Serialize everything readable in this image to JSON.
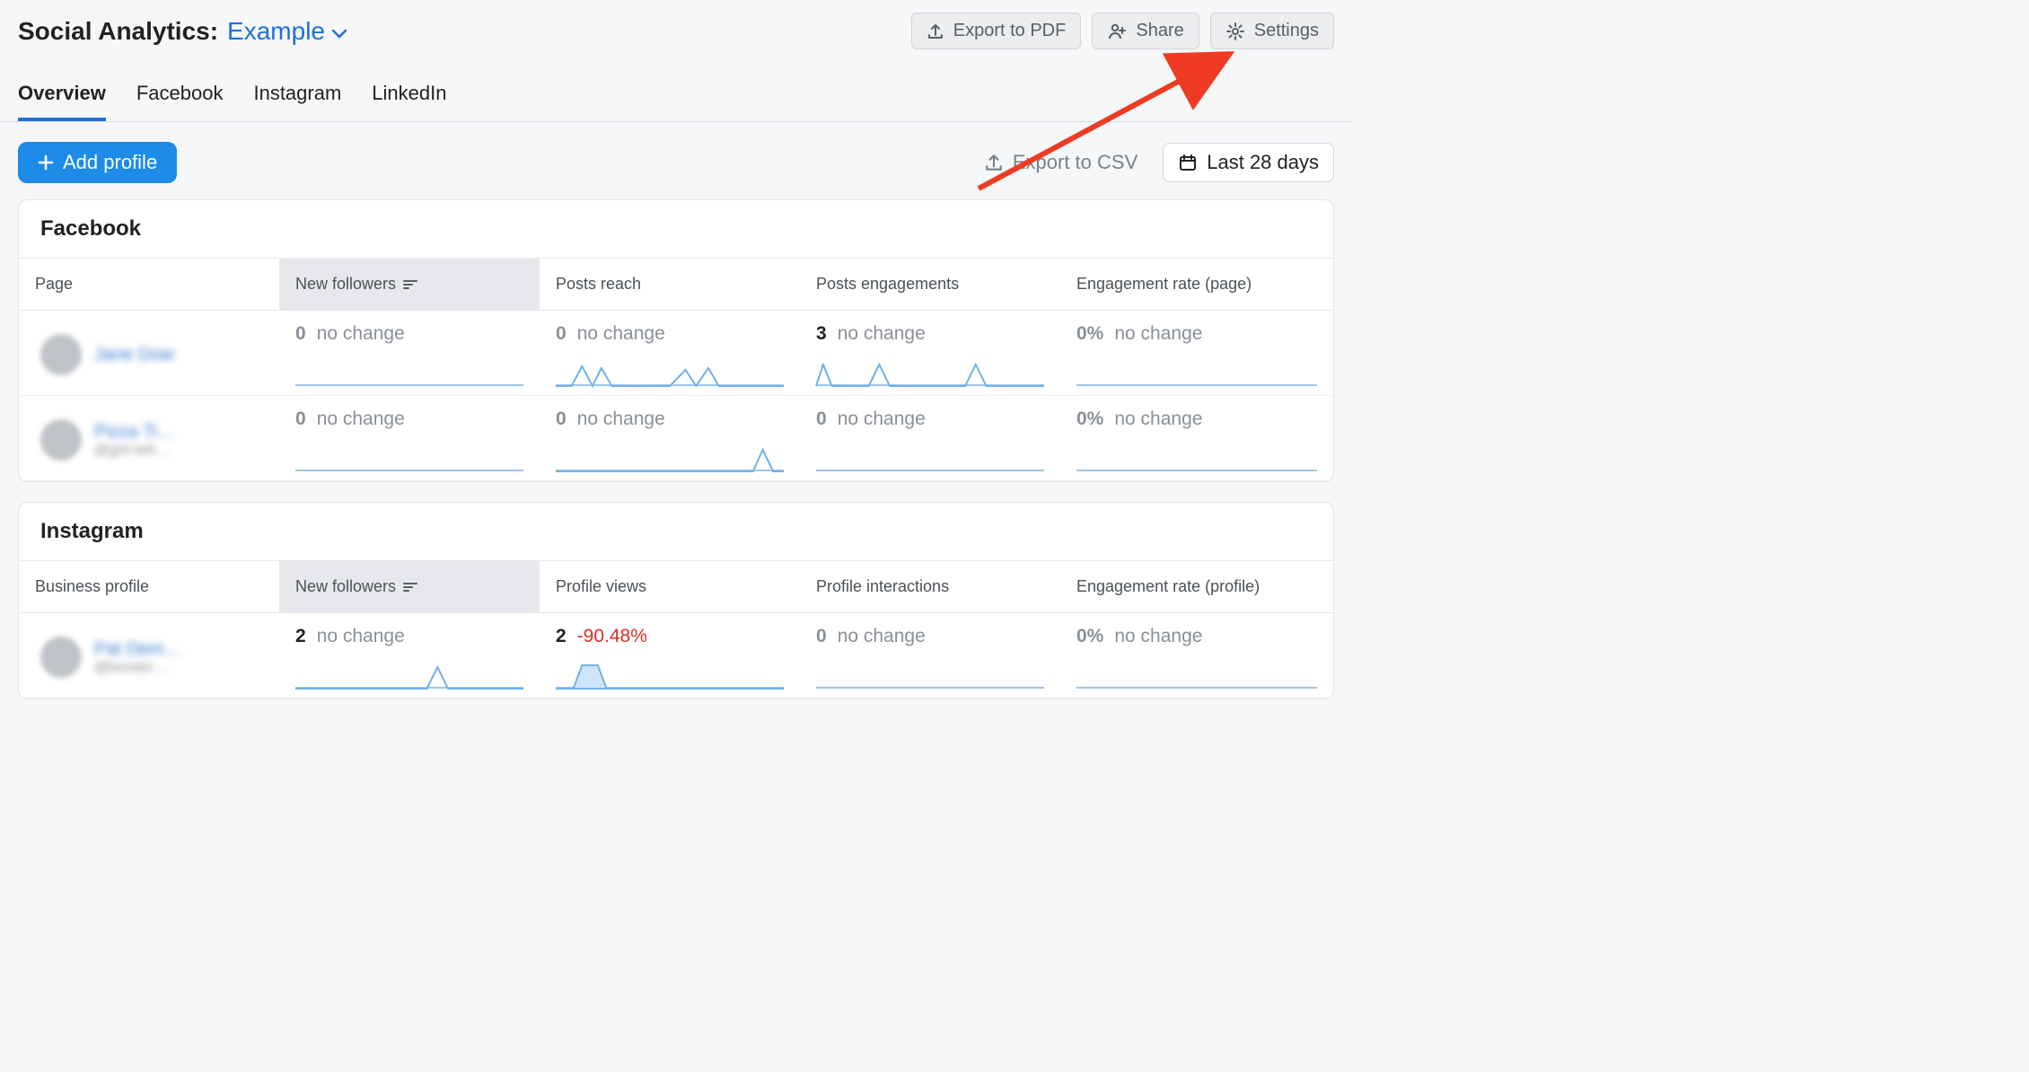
{
  "header": {
    "title_prefix": "Social Analytics:",
    "project_name": "Example",
    "buttons": {
      "export_pdf": "Export to PDF",
      "share": "Share",
      "settings": "Settings"
    }
  },
  "tabs": {
    "overview": "Overview",
    "facebook": "Facebook",
    "instagram": "Instagram",
    "linkedin": "LinkedIn"
  },
  "toolbar": {
    "add_profile": "Add profile",
    "export_csv": "Export to CSV",
    "date_range": "Last 28 days"
  },
  "facebook_panel": {
    "title": "Facebook",
    "columns": {
      "page": "Page",
      "new_followers": "New followers",
      "posts_reach": "Posts reach",
      "posts_engagements": "Posts engagements",
      "engagement_rate": "Engagement rate (page)"
    },
    "rows": [
      {
        "name": "Jane Dow",
        "sub": "",
        "new_followers": {
          "value": "0",
          "change": "no change"
        },
        "posts_reach": {
          "value": "0",
          "change": "no change"
        },
        "posts_engagements": {
          "value": "3",
          "change": "no change"
        },
        "engagement_rate": {
          "value": "0%",
          "change": "no change"
        }
      },
      {
        "name": "Pizza Ti…",
        "sub": "@grd twh…",
        "new_followers": {
          "value": "0",
          "change": "no change"
        },
        "posts_reach": {
          "value": "0",
          "change": "no change"
        },
        "posts_engagements": {
          "value": "0",
          "change": "no change"
        },
        "engagement_rate": {
          "value": "0%",
          "change": "no change"
        }
      }
    ]
  },
  "instagram_panel": {
    "title": "Instagram",
    "columns": {
      "profile": "Business profile",
      "new_followers": "New followers",
      "profile_views": "Profile views",
      "profile_interactions": "Profile interactions",
      "engagement_rate": "Engagement rate (profile)"
    },
    "rows": [
      {
        "name": "Pat Dem…",
        "sub": "@bonder…",
        "new_followers": {
          "value": "2",
          "change": "no change"
        },
        "profile_views": {
          "value": "2",
          "change": "-90.48%",
          "negative": true
        },
        "profile_interactions": {
          "value": "0",
          "change": "no change"
        },
        "engagement_rate": {
          "value": "0%",
          "change": "no change"
        }
      }
    ]
  }
}
